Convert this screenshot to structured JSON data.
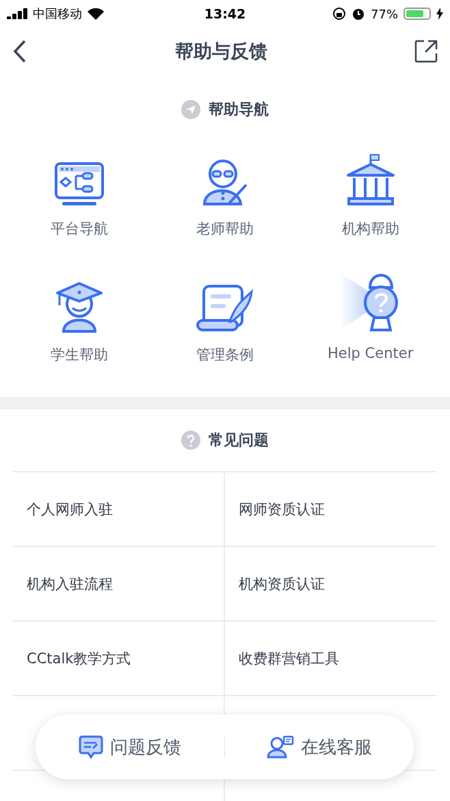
{
  "status_bar": {
    "carrier": "中国移动",
    "time": "13:42",
    "battery": "77%"
  },
  "nav": {
    "title": "帮助与反馈"
  },
  "help_nav": {
    "title": "帮助导航",
    "items": [
      {
        "label": "平台导航"
      },
      {
        "label": "老师帮助"
      },
      {
        "label": "机构帮助"
      },
      {
        "label": "学生帮助"
      },
      {
        "label": "管理条例"
      },
      {
        "label": "Help Center"
      }
    ]
  },
  "faq": {
    "title": "常见问题",
    "items": [
      "个人网师入驻",
      "网师资质认证",
      "机构入驻流程",
      "机构资质认证",
      "CCtalk教学方式",
      "收费群营销工具"
    ]
  },
  "bottom_bar": {
    "buttons": [
      {
        "label": "问题反馈"
      },
      {
        "label": "在线客服"
      }
    ]
  }
}
